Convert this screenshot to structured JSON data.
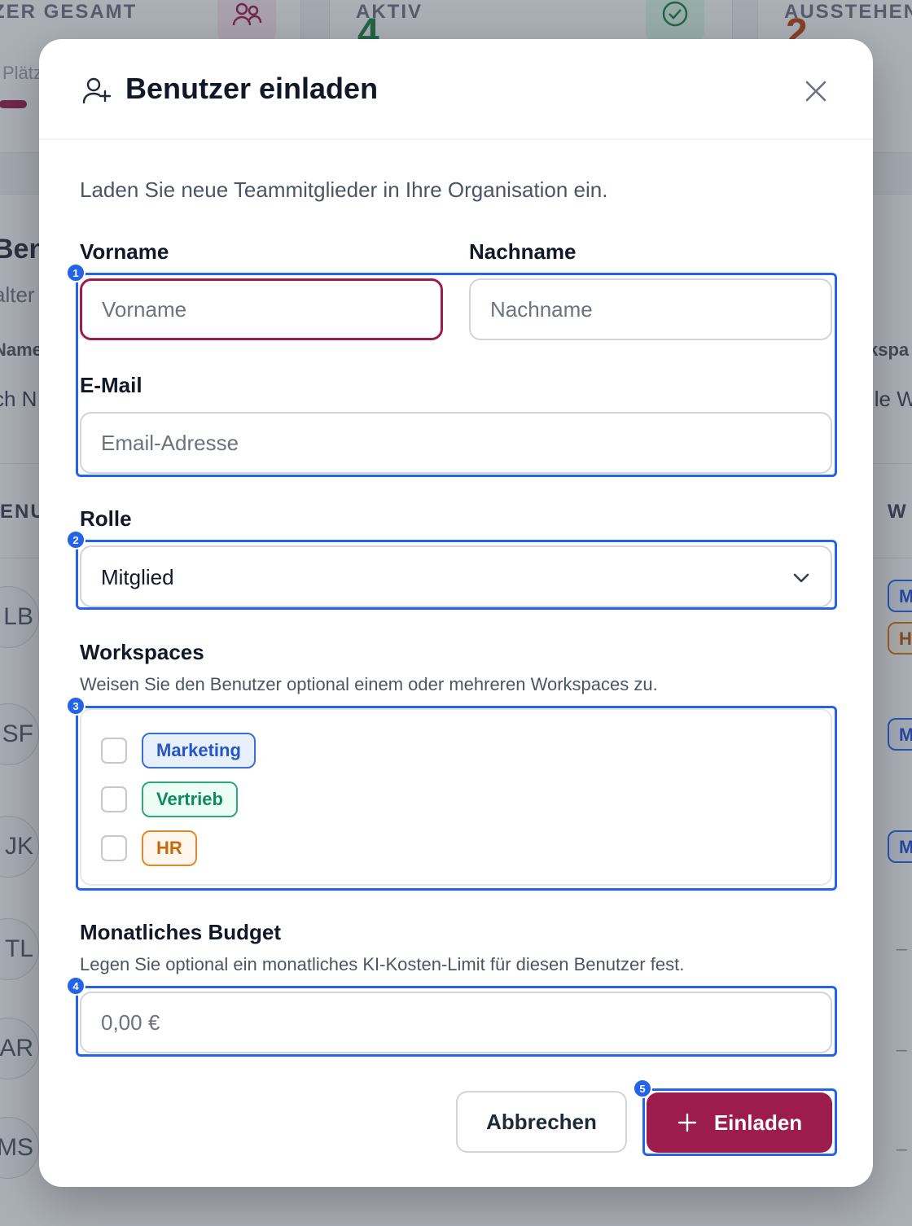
{
  "background": {
    "stats": [
      {
        "label": "ZER GESAMT",
        "value": "",
        "sub": "Plätz"
      },
      {
        "label": "AKTIV",
        "value": "4"
      },
      {
        "label": "AUSSTEHEN",
        "value": "2"
      }
    ],
    "list_title": "Ben",
    "list_subtitle": "alter",
    "col_name": "Name",
    "col_workspaces": "kspa",
    "filter_left": "ch N",
    "filter_right": "lle W",
    "section_left": "ENU",
    "section_right": "W",
    "avatars": [
      "LB",
      "SF",
      "JK",
      "TL",
      "AR",
      "MS"
    ],
    "badges": [
      "M",
      "H",
      "M",
      "M"
    ],
    "dashes": [
      "–",
      "–",
      "–"
    ],
    "colors": {
      "accent": "#9b1c4d",
      "active": "#15803d",
      "pending": "#c2410c"
    }
  },
  "modal": {
    "icon": "user-plus-icon",
    "title": "Benutzer einladen",
    "close_icon": "close-icon",
    "description": "Laden Sie neue Teammitglieder in Ihre Organisation ein.",
    "first_name": {
      "label": "Vorname",
      "placeholder": "Vorname",
      "value": ""
    },
    "last_name": {
      "label": "Nachname",
      "placeholder": "Nachname",
      "value": ""
    },
    "email": {
      "label": "E-Mail",
      "placeholder": "Email-Adresse",
      "value": ""
    },
    "role": {
      "label": "Rolle",
      "value": "Mitglied",
      "icon": "chevron-down-icon"
    },
    "workspaces": {
      "label": "Workspaces",
      "helper": "Weisen Sie den Benutzer optional einem oder mehreren Workspaces zu.",
      "items": [
        {
          "name": "Marketing",
          "checked": false,
          "color": "blue"
        },
        {
          "name": "Vertrieb",
          "checked": false,
          "color": "green"
        },
        {
          "name": "HR",
          "checked": false,
          "color": "orange"
        }
      ]
    },
    "budget": {
      "label": "Monatliches Budget",
      "helper": "Legen Sie optional ein monatliches KI-Kosten-Limit für diesen Benutzer fest.",
      "placeholder": "0,00 €"
    },
    "cancel_label": "Abbrechen",
    "invite_label": "Einladen",
    "invite_icon": "plus-icon",
    "accent_color": "#9b1c4d"
  },
  "annotations": [
    "1",
    "2",
    "3",
    "4",
    "5"
  ]
}
